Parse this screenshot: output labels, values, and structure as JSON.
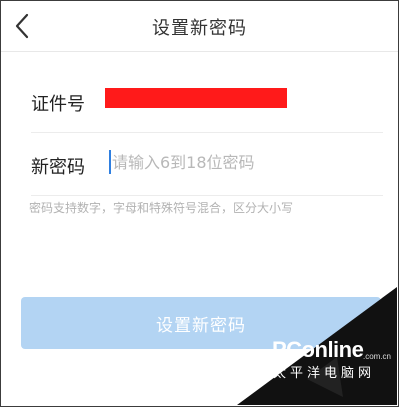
{
  "header": {
    "title": "设置新密码",
    "back_icon": "chevron-left-icon"
  },
  "form": {
    "id_label": "证件号",
    "password_label": "新密码",
    "password_value": "",
    "password_placeholder": "请输入6到18位密码",
    "hint": "密码支持数字，字母和特殊符号混合，区分大小写"
  },
  "actions": {
    "submit_label": "设置新密码"
  },
  "watermark": {
    "logo": "PConline",
    "domain": ".com.cn",
    "subtitle": "太平洋电脑网"
  },
  "colors": {
    "accent": "#2f7fe0",
    "button_disabled": "#b3d4f3",
    "redaction": "#ff1a1a"
  }
}
